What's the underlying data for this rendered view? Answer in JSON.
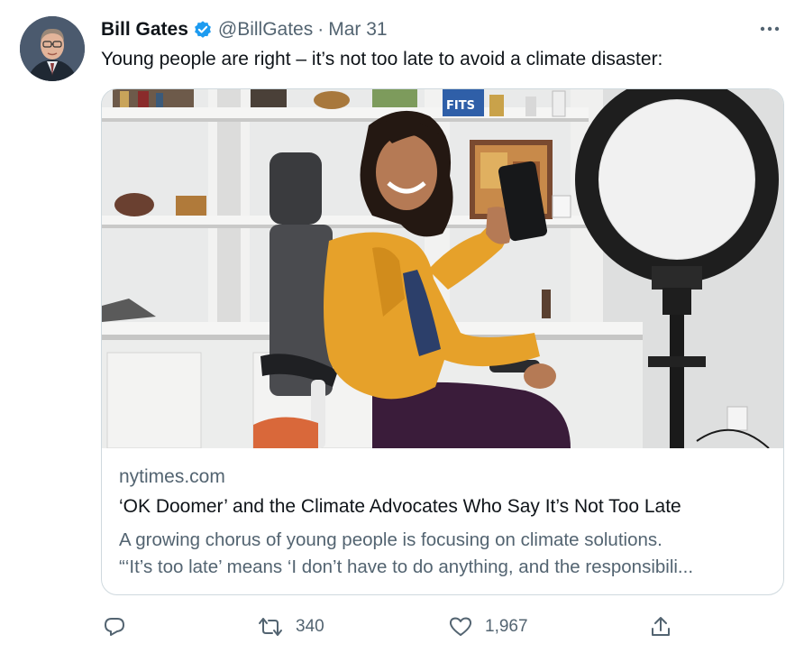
{
  "tweet": {
    "author_name": "Bill Gates",
    "handle": "@BillGates",
    "separator": "·",
    "date": "Mar 31",
    "text": "Young people are right – it’s not too late to avoid a climate disaster:"
  },
  "card": {
    "domain": "nytimes.com",
    "title": "‘OK Doomer’ and the Climate Advocates Who Say It’s Not Too Late",
    "description_line1": "A growing chorus of young people is focusing on climate solutions.",
    "description_line2": "“‘It’s too late’ means ‘I don’t have to do anything, and the responsibili...",
    "image_sign_text": "FITS"
  },
  "actions": {
    "reply_count": "",
    "retweet_count": "340",
    "like_count": "1,967"
  },
  "icons": {
    "verified": "verified-badge-icon",
    "more": "more-horizontal-icon",
    "reply": "reply-icon",
    "retweet": "retweet-icon",
    "like": "heart-icon",
    "share": "share-icon"
  },
  "colors": {
    "verified": "#1d9bf0",
    "secondary_text": "#536471",
    "primary_text": "#0f1419",
    "border": "#cfd9de"
  }
}
